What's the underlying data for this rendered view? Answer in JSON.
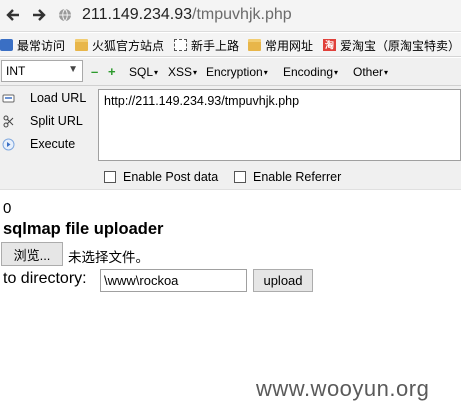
{
  "browser": {
    "url_host": "211.149.234.93",
    "url_path": "/tmpuvhjk.php"
  },
  "bookmarks": [
    {
      "label": "最常访问",
      "icon": "blue-gear-icon"
    },
    {
      "label": "火狐官方站点",
      "icon": "folder-icon"
    },
    {
      "label": "新手上路",
      "icon": "dashed-box-icon"
    },
    {
      "label": "常用网址",
      "icon": "folder-icon"
    },
    {
      "label": "爱淘宝（原淘宝特卖）",
      "icon": "taobao-icon"
    }
  ],
  "hackbar": {
    "int_select": "INT",
    "menus": [
      "SQL",
      "XSS",
      "Encryption",
      "Encoding",
      "Other"
    ],
    "actions": [
      {
        "label": "Load URL",
        "icon": "load-url-icon"
      },
      {
        "label": "Split URL",
        "icon": "split-url-icon"
      },
      {
        "label": "Execute",
        "icon": "execute-icon"
      }
    ],
    "url_text": "http://211.149.234.93/tmpuvhjk.php",
    "enable_post": "Enable Post data",
    "enable_referrer": "Enable Referrer"
  },
  "page": {
    "zero": "0",
    "title": "sqlmap file uploader",
    "browse_label": "浏览...",
    "no_file": "未选择文件。",
    "dir_label": "to directory:",
    "dir_value": "\\www\\rockoa",
    "upload_label": "upload"
  },
  "watermark": "www.wooyun.org"
}
